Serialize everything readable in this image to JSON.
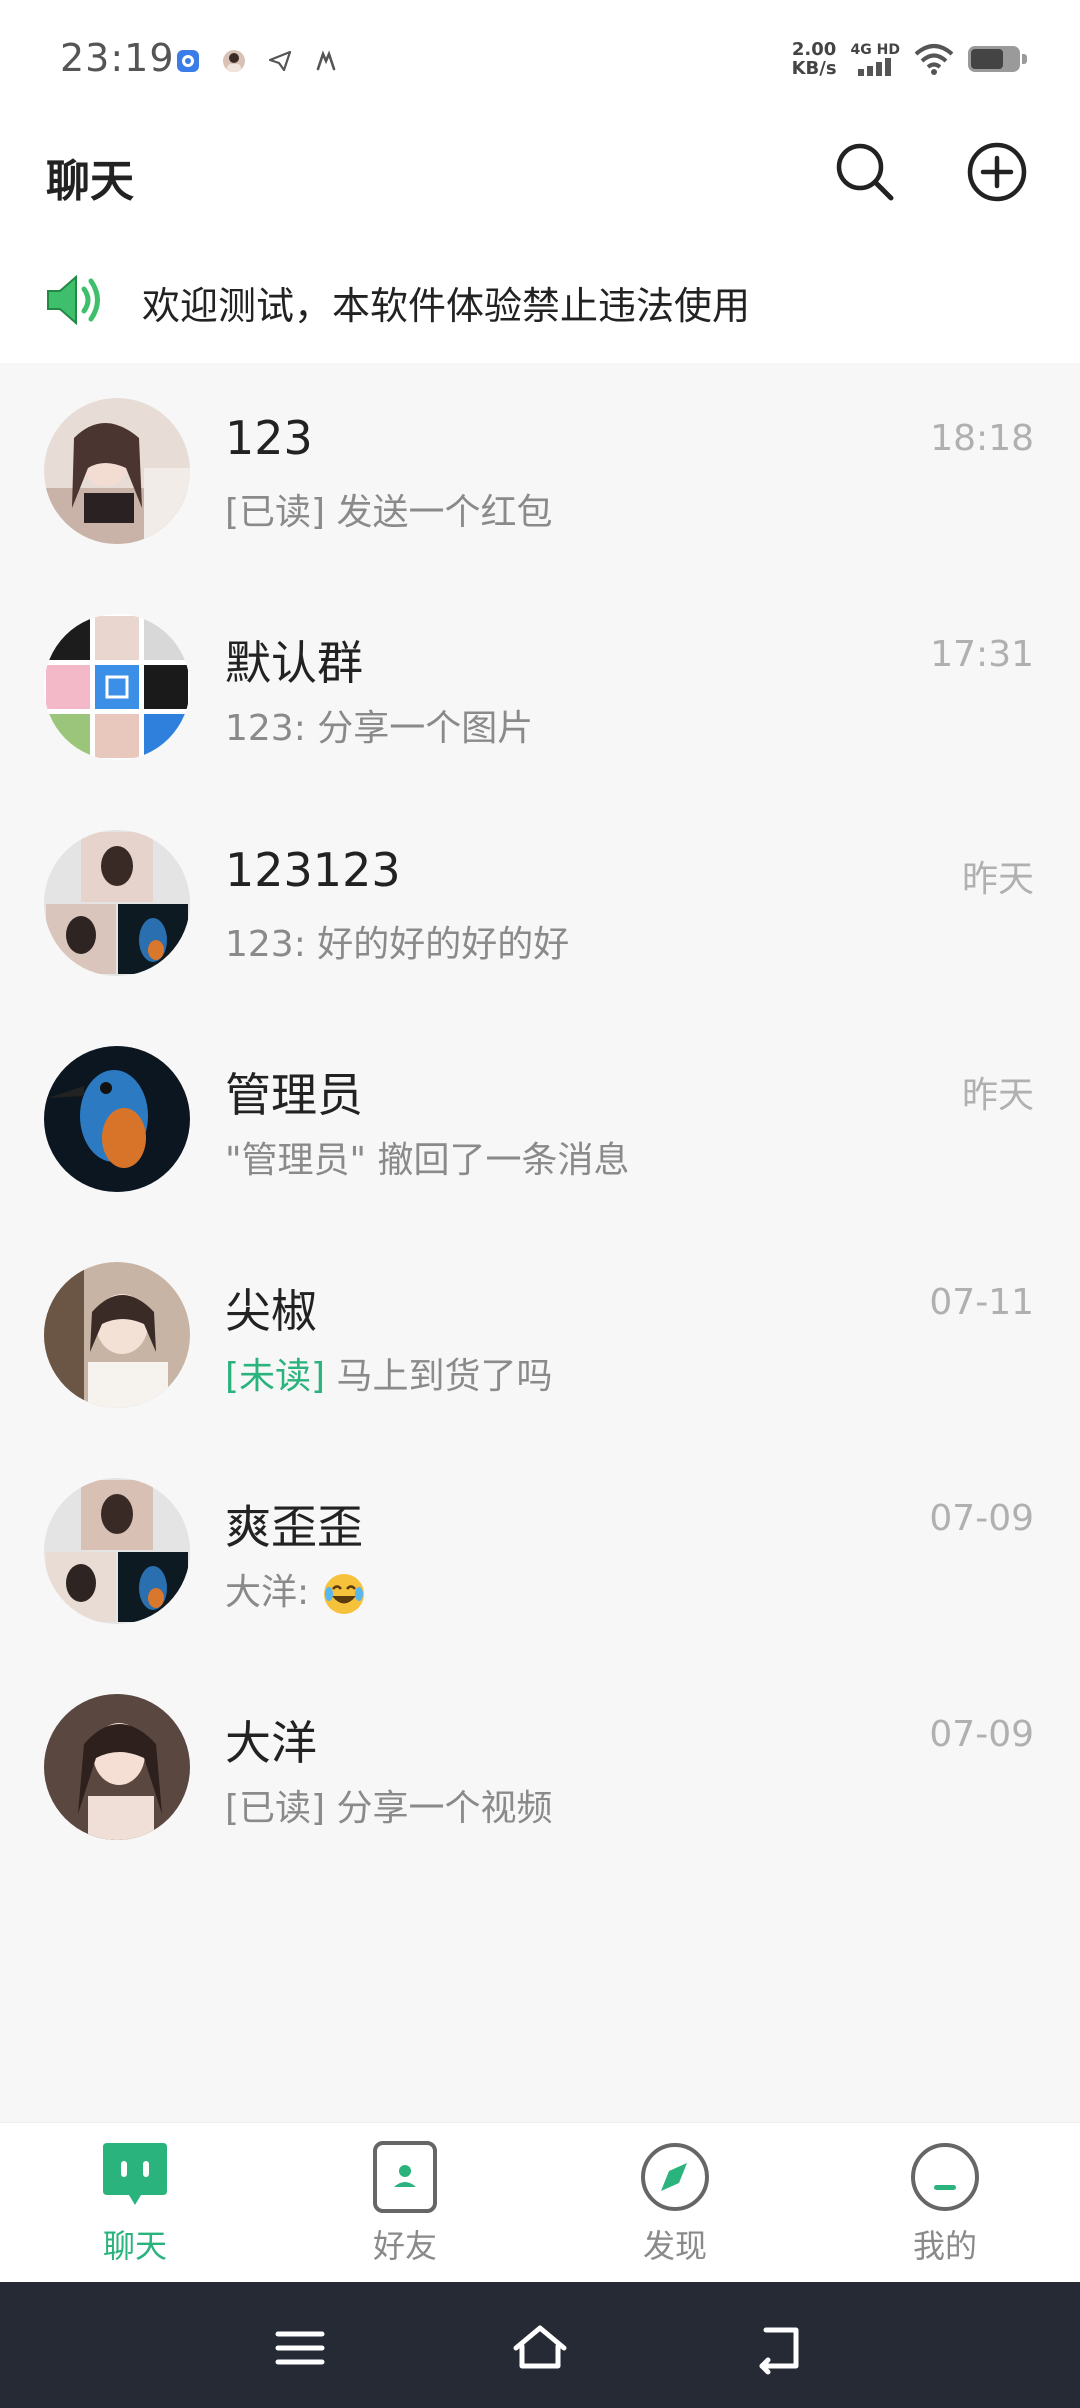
{
  "status_bar": {
    "time": "23:19",
    "net_speed_value": "2.00",
    "net_speed_unit": "KB/s",
    "net_type": "4G HD"
  },
  "header": {
    "title": "聊天",
    "search_icon": "search-icon",
    "add_icon": "plus-circle-icon"
  },
  "notice": {
    "icon": "speaker-icon",
    "text": "欢迎测试，本软件体验禁止违法使用"
  },
  "chats": [
    {
      "name": "123",
      "tag": "[已读]",
      "tag_type": "read",
      "preview": "发送一个红包",
      "time": "18:18"
    },
    {
      "name": "默认群",
      "tag": "",
      "tag_type": "",
      "preview": "123: 分享一个图片",
      "time": "17:31"
    },
    {
      "name": "123123",
      "tag": "",
      "tag_type": "",
      "preview": "123: 好的好的好的好",
      "time": "昨天"
    },
    {
      "name": "管理员",
      "tag": "",
      "tag_type": "",
      "preview": "\"管理员\" 撤回了一条消息",
      "time": "昨天"
    },
    {
      "name": "尖椒",
      "tag": "[未读]",
      "tag_type": "unread",
      "preview": "马上到货了吗",
      "time": "07-11"
    },
    {
      "name": "爽歪歪",
      "tag": "",
      "tag_type": "",
      "preview": "大洋: ",
      "time": "07-09"
    },
    {
      "name": "大洋",
      "tag": "[已读]",
      "tag_type": "read",
      "preview": "分享一个视频",
      "time": "07-09"
    }
  ],
  "tabs": [
    {
      "label": "聊天",
      "icon": "chat-icon",
      "active": true
    },
    {
      "label": "好友",
      "icon": "contacts-icon",
      "active": false
    },
    {
      "label": "发现",
      "icon": "compass-icon",
      "active": false
    },
    {
      "label": "我的",
      "icon": "profile-icon",
      "active": false
    }
  ],
  "colors": {
    "accent": "#2bb37e",
    "nav_bar": "#252a35"
  }
}
